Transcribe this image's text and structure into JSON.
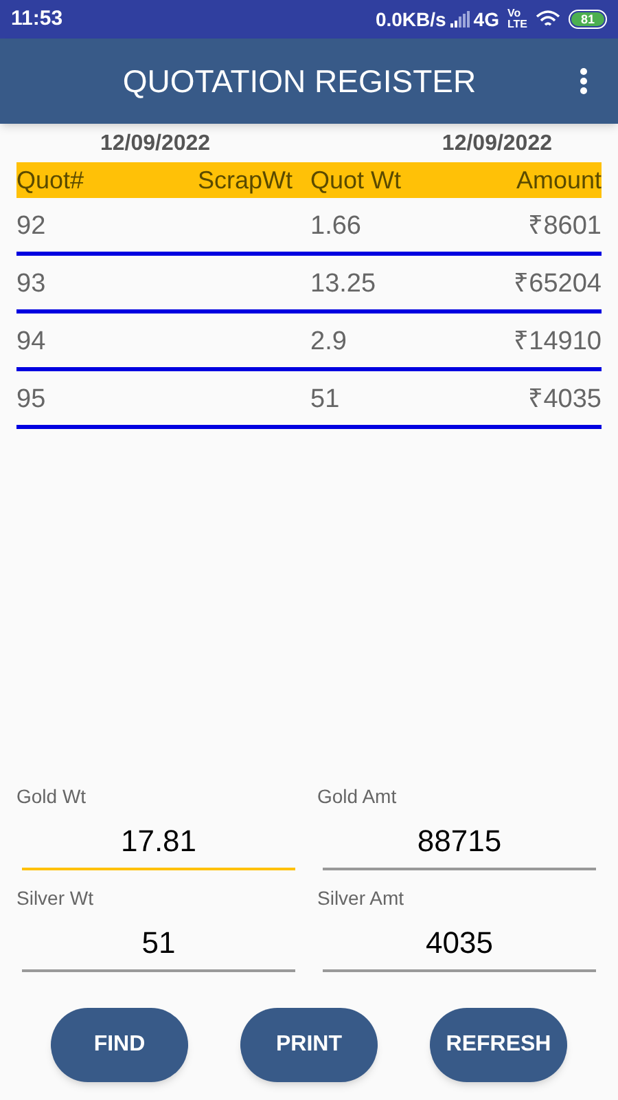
{
  "status_bar": {
    "time": "11:53",
    "speed": "0.0KB/s",
    "network": "4G",
    "volte_top": "Vo",
    "volte_bottom": "LTE",
    "battery": "81"
  },
  "app_bar": {
    "title": "QUOTATION REGISTER"
  },
  "dates": [
    "12/09/2022",
    "12/09/2022"
  ],
  "table": {
    "columns": [
      "Quot#",
      "ScrapWt",
      "Quot Wt",
      "Amount"
    ],
    "rows": [
      [
        "92",
        "",
        "1.66",
        "₹8601"
      ],
      [
        "93",
        "",
        "13.25",
        "₹65204"
      ],
      [
        "94",
        "",
        "2.9",
        "₹14910"
      ],
      [
        "95",
        "",
        "51",
        "₹4035"
      ]
    ]
  },
  "fields": [
    {
      "label": "Gold Wt",
      "value": "17.81",
      "focused": true
    },
    {
      "label": "Gold Amt",
      "value": "88715",
      "focused": false
    },
    {
      "label": "Silver Wt",
      "value": "51",
      "focused": false
    },
    {
      "label": "Silver Amt",
      "value": "4035",
      "focused": false
    }
  ],
  "buttons": [
    "FIND",
    "PRINT",
    "REFRESH"
  ]
}
